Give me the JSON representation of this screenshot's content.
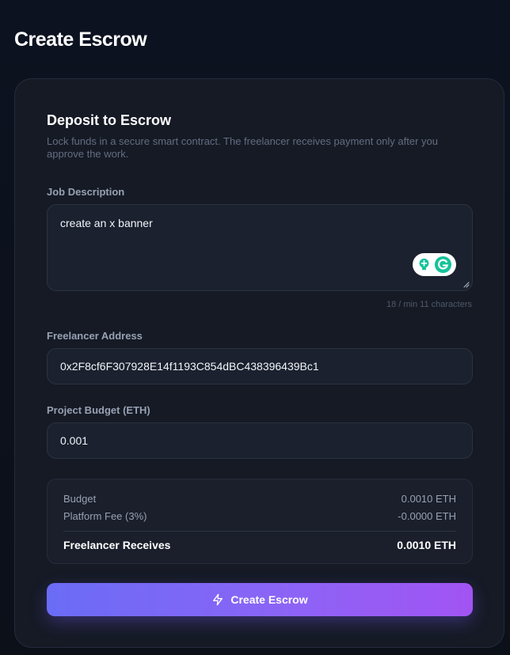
{
  "page": {
    "title": "Create Escrow"
  },
  "deposit": {
    "title": "Deposit to Escrow",
    "description": "Lock funds in a secure smart contract. The freelancer receives payment only after you approve the work."
  },
  "job_description": {
    "label": "Job Description",
    "value": "create an x banner",
    "counter": "18 / min 11 characters"
  },
  "freelancer_address": {
    "label": "Freelancer Address",
    "value": "0x2F8cf6F307928E14f1193C854dBC438396439Bc1"
  },
  "project_budget": {
    "label": "Project Budget (ETH)",
    "value": "0.001"
  },
  "summary": {
    "budget_label": "Budget",
    "budget_value": "0.0010 ETH",
    "fee_label": "Platform Fee (3%)",
    "fee_value": "-0.0000 ETH",
    "receives_label": "Freelancer Receives",
    "receives_value": "0.0010 ETH"
  },
  "actions": {
    "create_label": "Create Escrow",
    "create_icon": "lightning-icon"
  },
  "extensions": {
    "grammarly_icons": [
      "lightbulb-icon",
      "grammarly-icon"
    ]
  },
  "colors": {
    "background": "#0c111d",
    "card": "#151a25",
    "input": "#1b212e",
    "accent_start": "#6a6cf6",
    "accent_end": "#a254f3",
    "grammarly_green": "#15c39a"
  }
}
